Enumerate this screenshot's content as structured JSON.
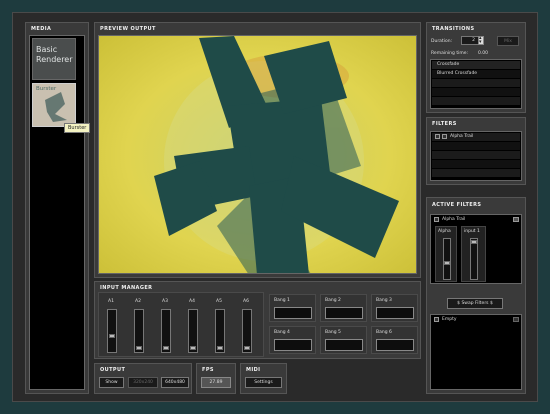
{
  "media": {
    "title": "MEDIA",
    "items": [
      {
        "label": "Basic Renderer"
      },
      {
        "label": "Burster"
      }
    ],
    "tooltip": "Burster"
  },
  "preview": {
    "title": "PREVIEW OUTPUT"
  },
  "input_manager": {
    "title": "INPUT MANAGER",
    "sliders": [
      {
        "label": "A1",
        "value": 0.35
      },
      {
        "label": "A2",
        "value": 0.05
      },
      {
        "label": "A3",
        "value": 0.05
      },
      {
        "label": "A4",
        "value": 0.05
      },
      {
        "label": "A5",
        "value": 0.05
      },
      {
        "label": "A6",
        "value": 0.05
      }
    ],
    "bangs": [
      "Bang 1",
      "Bang 2",
      "Bang 3",
      "Bang 4",
      "Bang 5",
      "Bang 6"
    ]
  },
  "output": {
    "title": "OUTPUT",
    "show_label": "Show",
    "res_1": "320x240",
    "res_2": "640x480"
  },
  "fps": {
    "title": "FPS",
    "value": "27.89"
  },
  "midi": {
    "title": "MIDI",
    "settings_label": "Settings"
  },
  "transitions": {
    "title": "TRANSITIONS",
    "duration_label": "Duration:",
    "duration_value": "2",
    "mix_label": "Mix",
    "remaining_label": "Remaining time:",
    "remaining_value": "0.00",
    "items": [
      "Crossfade",
      "Blurred Crossfade"
    ]
  },
  "filters": {
    "title": "FILTERS",
    "items": [
      {
        "label": "Alpha Trail"
      }
    ]
  },
  "active_filters": {
    "title": "ACTIVE FILTERS",
    "filter_name": "Alpha Trail",
    "params": [
      {
        "label": "Alpha",
        "value": 0.25
      },
      {
        "label": "input 1",
        "value": 0.95
      }
    ],
    "swap_label": "$ Swap Filters $",
    "slot2_label": "Empty"
  },
  "colors": {
    "background": "#1e3b3e",
    "panel": "#3a3a3a",
    "preview_yellow": "#e3d24b",
    "shape_teal": "#254f4c"
  },
  "icons": {
    "stepper": "up-down-arrows-icon",
    "move": "move-icon",
    "close": "close-icon"
  }
}
